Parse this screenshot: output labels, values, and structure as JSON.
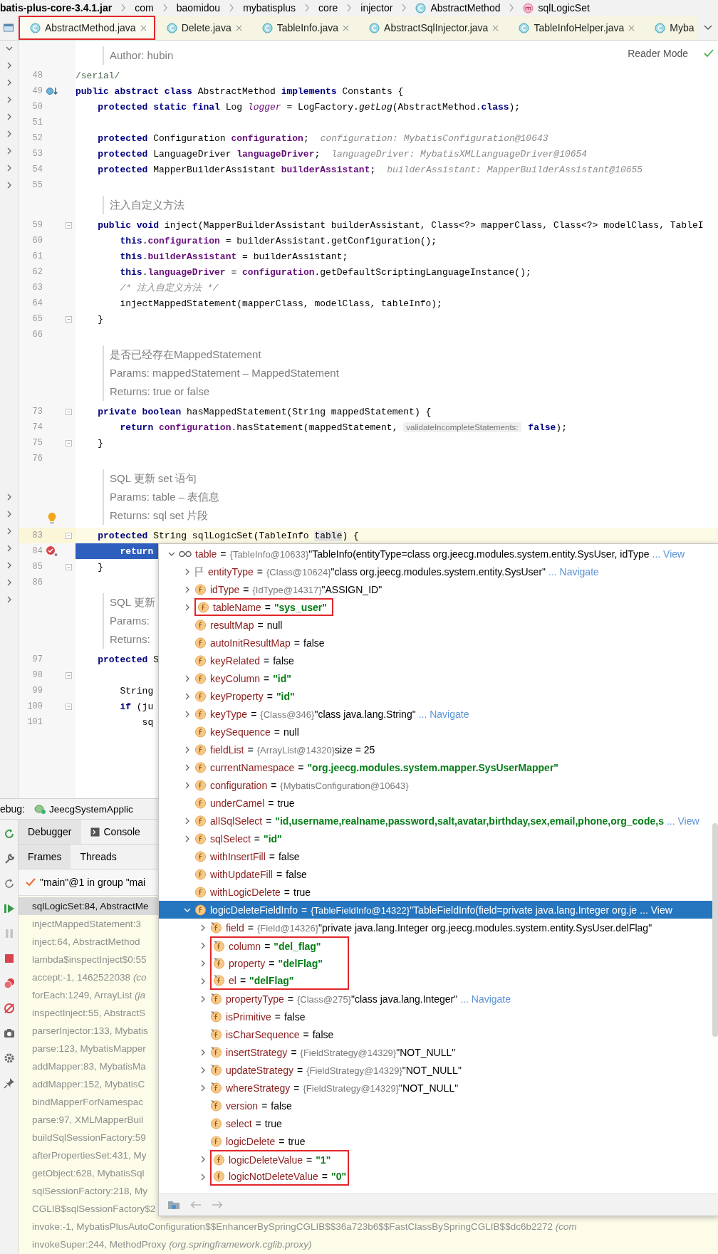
{
  "breadcrumb": [
    {
      "label": "batis-plus-core-3.4.1.jar"
    },
    {
      "label": "com"
    },
    {
      "label": "baomidou"
    },
    {
      "label": "mybatisplus"
    },
    {
      "label": "core"
    },
    {
      "label": "injector"
    },
    {
      "label": "AbstractMethod",
      "kind": "class"
    },
    {
      "label": "sqlLogicSet",
      "kind": "method"
    }
  ],
  "tabs": [
    {
      "label": "AbstractMethod.java",
      "selected": true,
      "annotated": true
    },
    {
      "label": "Delete.java",
      "selected": false,
      "annotated": false
    },
    {
      "label": "TableInfo.java",
      "selected": false,
      "annotated": false
    },
    {
      "label": "AbstractSqlInjector.java",
      "selected": false,
      "annotated": false
    },
    {
      "label": "TableInfoHelper.java",
      "selected": false,
      "annotated": false
    },
    {
      "label": "Myba",
      "selected": false,
      "annotated": false
    }
  ],
  "reader_mode": "Reader Mode",
  "editor": {
    "rows": [
      {
        "doc": [
          "Author: hubin"
        ]
      },
      {
        "num": "48",
        "caret": false,
        "exec": false,
        "tokens": [
          {
            "text": "/serial/",
            "kind": "doc"
          }
        ]
      },
      {
        "num": "49",
        "caret": false,
        "exec": false,
        "gutter": {
          "kind": "implemented"
        },
        "tokens": [
          {
            "text": "public abstract class",
            "kind": "keyword"
          },
          {
            "text": " AbstractMethod ",
            "kind": "plain"
          },
          {
            "text": "implements",
            "kind": "keyword"
          },
          {
            "text": " Constants {",
            "kind": "plain"
          }
        ]
      },
      {
        "num": "50",
        "caret": false,
        "exec": false,
        "tokens": [
          {
            "text": "    protected static final",
            "kind": "keyword"
          },
          {
            "text": " Log ",
            "kind": "plain"
          },
          {
            "text": "logger",
            "kind": "static"
          },
          {
            "text": " = LogFactory.",
            "kind": "plain"
          },
          {
            "text": "getLog",
            "kind": "italic"
          },
          {
            "text": "(AbstractMethod.",
            "kind": "plain"
          },
          {
            "text": "class",
            "kind": "keyword"
          },
          {
            "text": ");",
            "kind": "plain"
          }
        ]
      },
      {
        "num": "51",
        "caret": false,
        "exec": false
      },
      {
        "num": "52",
        "caret": false,
        "exec": false,
        "tokens": [
          {
            "text": "    protected",
            "kind": "keyword"
          },
          {
            "text": " Configuration ",
            "kind": "plain"
          },
          {
            "text": "configuration",
            "kind": "field"
          },
          {
            "text": ";",
            "kind": "plain"
          },
          {
            "text": "configuration: MybatisConfiguration@10643",
            "kind": "value"
          }
        ]
      },
      {
        "num": "53",
        "caret": false,
        "exec": false,
        "tokens": [
          {
            "text": "    protected",
            "kind": "keyword"
          },
          {
            "text": " LanguageDriver ",
            "kind": "plain"
          },
          {
            "text": "languageDriver",
            "kind": "field"
          },
          {
            "text": ";",
            "kind": "plain"
          },
          {
            "text": "languageDriver: MybatisXMLLanguageDriver@10654",
            "kind": "value"
          }
        ]
      },
      {
        "num": "54",
        "caret": false,
        "exec": false,
        "tokens": [
          {
            "text": "    protected",
            "kind": "keyword"
          },
          {
            "text": " MapperBuilderAssistant ",
            "kind": "plain"
          },
          {
            "text": "builderAssistant",
            "kind": "field"
          },
          {
            "text": ";",
            "kind": "plain"
          },
          {
            "text": "builderAssistant: MapperBuilderAssistant@10655",
            "kind": "value"
          }
        ]
      },
      {
        "num": "55",
        "caret": false,
        "exec": false
      },
      {
        "doc": [
          "注入自定义方法"
        ]
      },
      {
        "num": "59",
        "caret": false,
        "exec": false,
        "fold": true,
        "tokens": [
          {
            "text": "    public void",
            "kind": "keyword"
          },
          {
            "text": " inject(MapperBuilderAssistant builderAssistant, Class<?> mapperClass, Class<?> modelClass, TableI",
            "kind": "plain"
          }
        ]
      },
      {
        "num": "60",
        "caret": false,
        "exec": false,
        "tokens": [
          {
            "text": "        this",
            "kind": "keyword"
          },
          {
            "text": ".",
            "kind": "plain"
          },
          {
            "text": "configuration",
            "kind": "field"
          },
          {
            "text": " = builderAssistant.getConfiguration();",
            "kind": "plain"
          }
        ]
      },
      {
        "num": "61",
        "caret": false,
        "exec": false,
        "tokens": [
          {
            "text": "        this",
            "kind": "keyword"
          },
          {
            "text": ".",
            "kind": "plain"
          },
          {
            "text": "builderAssistant",
            "kind": "field"
          },
          {
            "text": " = builderAssistant;",
            "kind": "plain"
          }
        ]
      },
      {
        "num": "62",
        "caret": false,
        "exec": false,
        "tokens": [
          {
            "text": "        this",
            "kind": "keyword"
          },
          {
            "text": ".",
            "kind": "plain"
          },
          {
            "text": "languageDriver",
            "kind": "field"
          },
          {
            "text": " = ",
            "kind": "plain"
          },
          {
            "text": "configuration",
            "kind": "field"
          },
          {
            "text": ".getDefaultScriptingLanguageInstance();",
            "kind": "plain"
          }
        ]
      },
      {
        "num": "63",
        "caret": false,
        "exec": false,
        "tokens": [
          {
            "text": "        /* 注入自定义方法 */",
            "kind": "comment"
          }
        ]
      },
      {
        "num": "64",
        "caret": false,
        "exec": false,
        "tokens": [
          {
            "text": "        injectMappedStatement(mapperClass, modelClass, tableInfo);",
            "kind": "plain"
          }
        ]
      },
      {
        "num": "65",
        "caret": false,
        "exec": false,
        "fold": true,
        "tokens": [
          {
            "text": "    }",
            "kind": "plain"
          }
        ]
      },
      {
        "num": "66",
        "caret": false,
        "exec": false
      },
      {
        "doc": [
          "是否已经存在MappedStatement",
          "Params: mappedStatement – MappedStatement",
          "Returns: true or false"
        ]
      },
      {
        "num": "73",
        "caret": false,
        "exec": false,
        "fold": true,
        "tokens": [
          {
            "text": "    private boolean",
            "kind": "keyword"
          },
          {
            "text": " hasMappedStatement(String mappedStatement) {",
            "kind": "plain"
          }
        ]
      },
      {
        "num": "74",
        "caret": false,
        "exec": false,
        "tokens": [
          {
            "text": "        return",
            "kind": "keyword"
          },
          {
            "text": " configuration",
            "kind": "field"
          },
          {
            "text": ".hasStatement(mappedStatement, ",
            "kind": "plain"
          },
          {
            "text": "validateIncompleteStatements:",
            "kind": "hint"
          },
          {
            "text": " false",
            "kind": "keyword"
          },
          {
            "text": ");",
            "kind": "plain"
          }
        ]
      },
      {
        "num": "75",
        "caret": false,
        "exec": false,
        "fold": true,
        "tokens": [
          {
            "text": "    }",
            "kind": "plain"
          }
        ]
      },
      {
        "num": "76",
        "caret": false,
        "exec": false
      },
      {
        "doc": [
          "SQL 更新 set 语句",
          "Params: table – 表信息",
          "Returns: sql set 片段"
        ],
        "bulb": true
      },
      {
        "num": "83",
        "caret": true,
        "exec": false,
        "fold": true,
        "tokens": [
          {
            "text": "    protected",
            "kind": "keyword"
          },
          {
            "text": " String sqlLogicSet(TableInfo ",
            "kind": "plain"
          },
          {
            "text": "table",
            "kind": "param"
          },
          {
            "text": ") {",
            "kind": "plain"
          }
        ]
      },
      {
        "num": "84",
        "caret": false,
        "exec": true,
        "gutter": {
          "kind": "breakpoint"
        },
        "tokens": [
          {
            "text": "        return",
            "kind": "keyword"
          }
        ]
      },
      {
        "num": "85",
        "caret": false,
        "exec": false,
        "fold": true,
        "tokens": [
          {
            "text": "    }",
            "kind": "plain"
          }
        ]
      },
      {
        "num": "86",
        "caret": false,
        "exec": false
      },
      {
        "doc": [
          "SQL 更新",
          "Params:",
          "Returns:"
        ]
      },
      {
        "num": "97",
        "caret": false,
        "exec": false,
        "tokens": [
          {
            "text": "    protected",
            "kind": "keyword"
          },
          {
            "text": " S",
            "kind": "plain"
          }
        ]
      },
      {
        "num": "98",
        "caret": false,
        "exec": false,
        "fold": true
      },
      {
        "num": "99",
        "caret": false,
        "exec": false,
        "tokens": [
          {
            "text": "        String",
            "kind": "plain"
          }
        ]
      },
      {
        "num": "100",
        "caret": false,
        "exec": false,
        "fold": true,
        "tokens": [
          {
            "text": "        if",
            "kind": "keyword"
          },
          {
            "text": " (ju",
            "kind": "plain"
          }
        ]
      },
      {
        "num": "101",
        "caret": false,
        "exec": false,
        "tokens": [
          {
            "text": "            sq",
            "kind": "plain"
          }
        ]
      }
    ]
  },
  "debug": {
    "label": "ebug:",
    "session": "JeecgSystemApplic",
    "tabs": [
      {
        "label": "Debugger",
        "selected": true
      },
      {
        "label": "Console",
        "selected": false
      }
    ],
    "subtabs": [
      {
        "label": "Frames",
        "selected": true
      },
      {
        "label": "Threads",
        "selected": false
      }
    ],
    "thread": "\"main\"@1 in group \"mai",
    "frames": [
      {
        "text": "sqlLogicSet:84, AbstractMe",
        "selected": true
      },
      {
        "text": "injectMappedStatement:3",
        "selected": false
      },
      {
        "text": "inject:64, AbstractMethod",
        "selected": false
      },
      {
        "text": "lambda$inspectInject$0:55",
        "selected": false
      },
      {
        "text": "accept:-1, 1462522038 *(co*",
        "selected": false
      },
      {
        "text": "forEach:1249, ArrayList *(ja*",
        "selected": false
      },
      {
        "text": "inspectInject:55, AbstractS",
        "selected": false
      },
      {
        "text": "parserInjector:133, Mybatis",
        "selected": false
      },
      {
        "text": "parse:123, MybatisMapper",
        "selected": false
      },
      {
        "text": "addMapper:83, MybatisMa",
        "selected": false
      },
      {
        "text": "addMapper:152, MybatisC",
        "selected": false
      },
      {
        "text": "bindMapperForNamespac",
        "selected": false
      },
      {
        "text": "parse:97, XMLMapperBuil",
        "selected": false
      },
      {
        "text": "buildSqlSessionFactory:59",
        "selected": false
      },
      {
        "text": "afterPropertiesSet:431, My",
        "selected": false
      },
      {
        "text": "getObject:628, MybatisSql",
        "selected": false
      },
      {
        "text": "sqlSessionFactory:218, My",
        "selected": false
      },
      {
        "text": "CGLIB$sqlSessionFactory$2",
        "selected": false
      },
      {
        "text": "invoke:-1, MybatisPlusAutoConfiguration$$EnhancerBySpringCGLIB$$36a723b6$$FastClassBySpringCGLIB$$dc6b2272 *(com*",
        "selected": false
      },
      {
        "text": "invokeSuper:244, MethodProxy *(org.springframework.cglib.proxy)*",
        "selected": false
      }
    ]
  },
  "variables": {
    "tree": [
      {
        "name": "table",
        "eq": "=",
        "kind": "watch",
        "type": "{TableInfo@10633}",
        "value": {
          "text": "\"TableInfo(entityType=class org.jeecg.modules.system.entity.SysUser, idType",
          "kind": "plain"
        },
        "link": "... View",
        "expanded": true,
        "selected": false,
        "annotated": false,
        "children": [
          {
            "name": "entityType",
            "eq": "=",
            "kind": "flag",
            "type": "{Class@10624}",
            "value": {
              "text": "\"class org.jeecg.modules.system.entity.SysUser\"",
              "kind": "plain"
            },
            "link": "... Navigate",
            "expanded": false,
            "selected": false,
            "annotated": false
          },
          {
            "name": "idType",
            "eq": "=",
            "kind": "field",
            "type": "{IdType@14317}",
            "value": {
              "text": "\"ASSIGN_ID\"",
              "kind": "plain"
            },
            "expanded": false,
            "selected": false,
            "annotated": false
          },
          {
            "name": "tableName",
            "eq": "=",
            "kind": "field",
            "value": {
              "text": "\"sys_user\"",
              "kind": "string"
            },
            "expanded": false,
            "selected": false,
            "annotated": true
          },
          {
            "name": "resultMap",
            "eq": "=",
            "kind": "field",
            "value": {
              "text": "null",
              "kind": "plain"
            },
            "selected": false,
            "annotated": false
          },
          {
            "name": "autoInitResultMap",
            "eq": "=",
            "kind": "field",
            "value": {
              "text": "false",
              "kind": "plain"
            },
            "selected": false,
            "annotated": false
          },
          {
            "name": "keyRelated",
            "eq": "=",
            "kind": "field",
            "value": {
              "text": "false",
              "kind": "plain"
            },
            "selected": false,
            "annotated": false
          },
          {
            "name": "keyColumn",
            "eq": "=",
            "kind": "field",
            "value": {
              "text": "\"id\"",
              "kind": "string"
            },
            "expanded": false,
            "selected": false,
            "annotated": false
          },
          {
            "name": "keyProperty",
            "eq": "=",
            "kind": "field",
            "value": {
              "text": "\"id\"",
              "kind": "string"
            },
            "expanded": false,
            "selected": false,
            "annotated": false
          },
          {
            "name": "keyType",
            "eq": "=",
            "kind": "field",
            "type": "{Class@346}",
            "value": {
              "text": "\"class java.lang.String\"",
              "kind": "plain"
            },
            "link": "... Navigate",
            "expanded": false,
            "selected": false,
            "annotated": false
          },
          {
            "name": "keySequence",
            "eq": "=",
            "kind": "field",
            "value": {
              "text": "null",
              "kind": "plain"
            },
            "selected": false,
            "annotated": false
          },
          {
            "name": "fieldList",
            "eq": "=",
            "kind": "field",
            "type": "{ArrayList@14320}",
            "value": {
              "text": "size = 25",
              "kind": "plain"
            },
            "expanded": false,
            "selected": false,
            "annotated": false
          },
          {
            "name": "currentNamespace",
            "eq": "=",
            "kind": "field",
            "value": {
              "text": "\"org.jeecg.modules.system.mapper.SysUserMapper\"",
              "kind": "string"
            },
            "expanded": false,
            "selected": false,
            "annotated": false
          },
          {
            "name": "configuration",
            "eq": "=",
            "kind": "field",
            "type": "{MybatisConfiguration@10643}",
            "expanded": false,
            "selected": false,
            "annotated": false
          },
          {
            "name": "underCamel",
            "eq": "=",
            "kind": "field",
            "value": {
              "text": "true",
              "kind": "plain"
            },
            "selected": false,
            "annotated": false
          },
          {
            "name": "allSqlSelect",
            "eq": "=",
            "kind": "field",
            "value": {
              "text": "\"id,username,realname,password,salt,avatar,birthday,sex,email,phone,org_code,s",
              "kind": "string"
            },
            "link": "... View",
            "expanded": false,
            "selected": false,
            "annotated": false
          },
          {
            "name": "sqlSelect",
            "eq": "=",
            "kind": "field",
            "value": {
              "text": "\"id\"",
              "kind": "string"
            },
            "expanded": false,
            "selected": false,
            "annotated": false
          },
          {
            "name": "withInsertFill",
            "eq": "=",
            "kind": "field",
            "value": {
              "text": "false",
              "kind": "plain"
            },
            "selected": false,
            "annotated": false
          },
          {
            "name": "withUpdateFill",
            "eq": "=",
            "kind": "field",
            "value": {
              "text": "false",
              "kind": "plain"
            },
            "selected": false,
            "annotated": false
          },
          {
            "name": "withLogicDelete",
            "eq": "=",
            "kind": "field",
            "value": {
              "text": "true",
              "kind": "plain"
            },
            "selected": false,
            "annotated": false
          },
          {
            "name": "logicDeleteFieldInfo",
            "eq": "=",
            "kind": "field",
            "type": "{TableFieldInfo@14322}",
            "value": {
              "text": "\"TableFieldInfo(field=private java.lang.Integer org.je",
              "kind": "plain"
            },
            "link": "... View",
            "expanded": true,
            "selected": true,
            "annotated": false,
            "children": [
              {
                "name": "field",
                "eq": "=",
                "kind": "field_final",
                "type": "{Field@14326}",
                "value": {
                  "text": "\"private java.lang.Integer org.jeecg.modules.system.entity.SysUser.delFlag\"",
                  "kind": "plain"
                },
                "expanded": false,
                "selected": false,
                "annotated": false
              },
              {
                "name": "column",
                "eq": "=",
                "kind": "field_final",
                "value": {
                  "text": "\"del_flag\"",
                  "kind": "string"
                },
                "expanded": false,
                "selected": false,
                "annotated": true
              },
              {
                "name": "property",
                "eq": "=",
                "kind": "field_final",
                "value": {
                  "text": "\"delFlag\"",
                  "kind": "string"
                },
                "expanded": false,
                "selected": false,
                "annotated": true
              },
              {
                "name": "el",
                "eq": "=",
                "kind": "field_final",
                "value": {
                  "text": "\"delFlag\"",
                  "kind": "string"
                },
                "expanded": false,
                "selected": false,
                "annotated": true
              },
              {
                "name": "propertyType",
                "eq": "=",
                "kind": "field_final",
                "type": "{Class@275}",
                "value": {
                  "text": "\"class java.lang.Integer\"",
                  "kind": "plain"
                },
                "link": "... Navigate",
                "expanded": false,
                "selected": false,
                "annotated": false
              },
              {
                "name": "isPrimitive",
                "eq": "=",
                "kind": "field_final",
                "value": {
                  "text": "false",
                  "kind": "plain"
                },
                "selected": false,
                "annotated": false
              },
              {
                "name": "isCharSequence",
                "eq": "=",
                "kind": "field_final",
                "value": {
                  "text": "false",
                  "kind": "plain"
                },
                "selected": false,
                "annotated": false
              },
              {
                "name": "insertStrategy",
                "eq": "=",
                "kind": "field_final",
                "type": "{FieldStrategy@14329}",
                "value": {
                  "text": "\"NOT_NULL\"",
                  "kind": "plain"
                },
                "expanded": false,
                "selected": false,
                "annotated": false
              },
              {
                "name": "updateStrategy",
                "eq": "=",
                "kind": "field_final",
                "type": "{FieldStrategy@14329}",
                "value": {
                  "text": "\"NOT_NULL\"",
                  "kind": "plain"
                },
                "expanded": false,
                "selected": false,
                "annotated": false
              },
              {
                "name": "whereStrategy",
                "eq": "=",
                "kind": "field_final",
                "type": "{FieldStrategy@14329}",
                "value": {
                  "text": "\"NOT_NULL\"",
                  "kind": "plain"
                },
                "expanded": false,
                "selected": false,
                "annotated": false
              },
              {
                "name": "version",
                "eq": "=",
                "kind": "field_final",
                "value": {
                  "text": "false",
                  "kind": "plain"
                },
                "selected": false,
                "annotated": false
              },
              {
                "name": "select",
                "eq": "=",
                "kind": "field",
                "value": {
                  "text": "true",
                  "kind": "plain"
                },
                "selected": false,
                "annotated": false
              },
              {
                "name": "logicDelete",
                "eq": "=",
                "kind": "field",
                "value": {
                  "text": "true",
                  "kind": "plain"
                },
                "selected": false,
                "annotated": false
              },
              {
                "name": "logicDeleteValue",
                "eq": "=",
                "kind": "field",
                "value": {
                  "text": "\"1\"",
                  "kind": "string"
                },
                "expanded": false,
                "selected": false,
                "annotated": true
              },
              {
                "name": "logicNotDeleteValue",
                "eq": "=",
                "kind": "field",
                "value": {
                  "text": "\"0\"",
                  "kind": "string"
                },
                "expanded": false,
                "selected": false,
                "annotated": true
              }
            ]
          }
        ]
      }
    ]
  }
}
